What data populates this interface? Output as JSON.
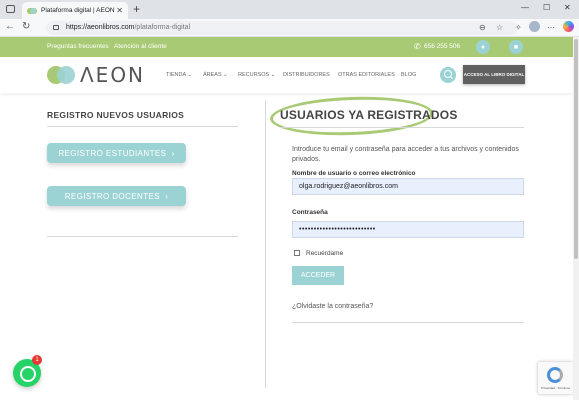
{
  "browser": {
    "tab_title": "Plataforma digital | AEON",
    "url_domain": "https://aeonlibros.com",
    "url_path": "/plataforma-digital"
  },
  "topbar": {
    "faq": "Preguntas frecuentes",
    "customer": "Atención al cliente",
    "phone": "656 255 506"
  },
  "header": {
    "logo_text": "ΛEON",
    "menu": [
      "TIENDA",
      "ÁREAS",
      "RECURSOS",
      "DISTRIBUIDORES",
      "OTRAS EDITORIALES",
      "BLOG"
    ],
    "access_button": "ACCESO AL LIBRO DIGITAL"
  },
  "left": {
    "title": "REGISTRO NUEVOS USUARIOS",
    "btn_students": "REGISTRO ESTUDIANTES",
    "btn_teachers": "REGISTRO DOCENTES"
  },
  "right": {
    "title": "USUARIOS YA REGISTRADOS",
    "intro": "Introduce tu email y contraseña para acceder a tus archivos y contenidos privados.",
    "username_label": "Nombre de usuario o correo electrónico",
    "username_value": "olga.rodriguez@aeonlibros.com",
    "password_label": "Contraseña",
    "password_value": "••••••••••••••••••••••••••",
    "remember_label": "Recuérdame",
    "submit": "ACCEDER",
    "forgot": "¿Olvidaste la contraseña?"
  },
  "widgets": {
    "whatsapp_badge": "1",
    "recaptcha_text": "Privacidad - Términos"
  },
  "colors": {
    "green": "#a9ca75",
    "teal": "#9bd3d4",
    "dark_button": "#606060"
  }
}
